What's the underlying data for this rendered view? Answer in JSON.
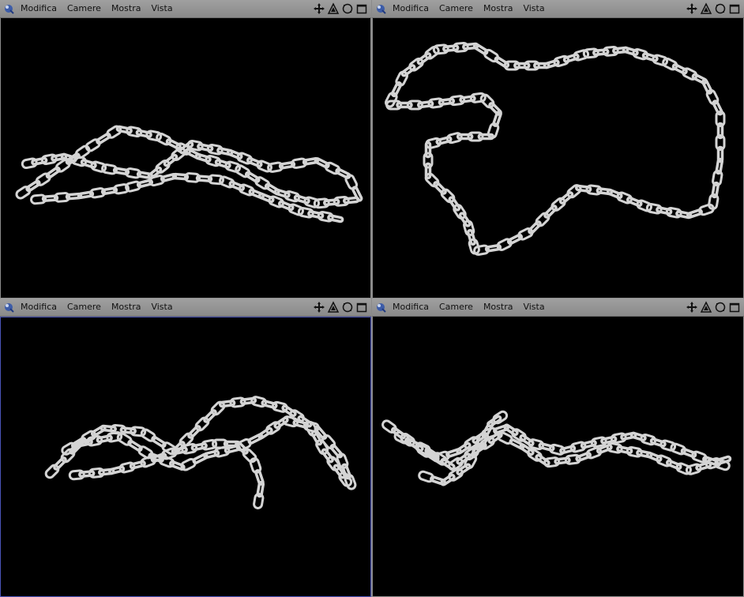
{
  "menu": [
    "Modifica",
    "Camere",
    "Mostra",
    "Vista"
  ],
  "viewports": [
    {
      "id": "top-left",
      "active": false,
      "view": "perspective-low"
    },
    {
      "id": "top-right",
      "active": false,
      "view": "top"
    },
    {
      "id": "bottom-left",
      "active": true,
      "view": "front"
    },
    {
      "id": "bottom-right",
      "active": false,
      "view": "side"
    }
  ],
  "tools": [
    "move-icon",
    "rotate-icon",
    "scale-icon",
    "maximize-icon"
  ],
  "colors": {
    "viewport_bg": "#000000",
    "header_bg": "#8a8a8a",
    "active_border": "#4a54b8",
    "chain": "#d4d4d4"
  }
}
